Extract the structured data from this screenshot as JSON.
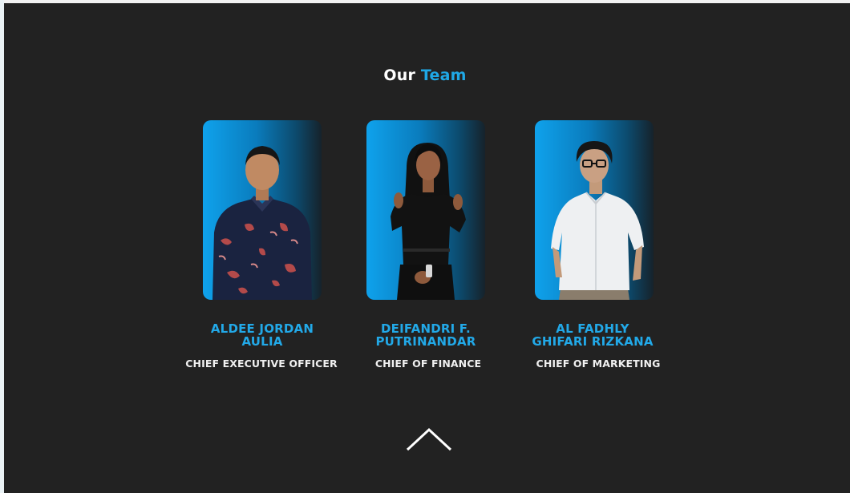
{
  "section": {
    "title_part1": "Our",
    "title_part2": "Team"
  },
  "team": [
    {
      "name_line1": "ALDEE JORDAN",
      "name_line2": "AULIA",
      "role": "CHIEF EXECUTIVE OFFICER"
    },
    {
      "name_line1": "DEIFANDRI F.",
      "name_line2": "PUTRINANDAR",
      "role": "CHIEF OF FINANCE"
    },
    {
      "name_line1": "AL FADHLY",
      "name_line2": "GHIFARI RIZKANA",
      "role": "CHIEF OF MARKETING"
    }
  ],
  "colors": {
    "background": "#222222",
    "accent": "#1fa8e6",
    "text": "#ffffff"
  },
  "icons": {
    "scroll_up": "chevron-up-icon"
  }
}
